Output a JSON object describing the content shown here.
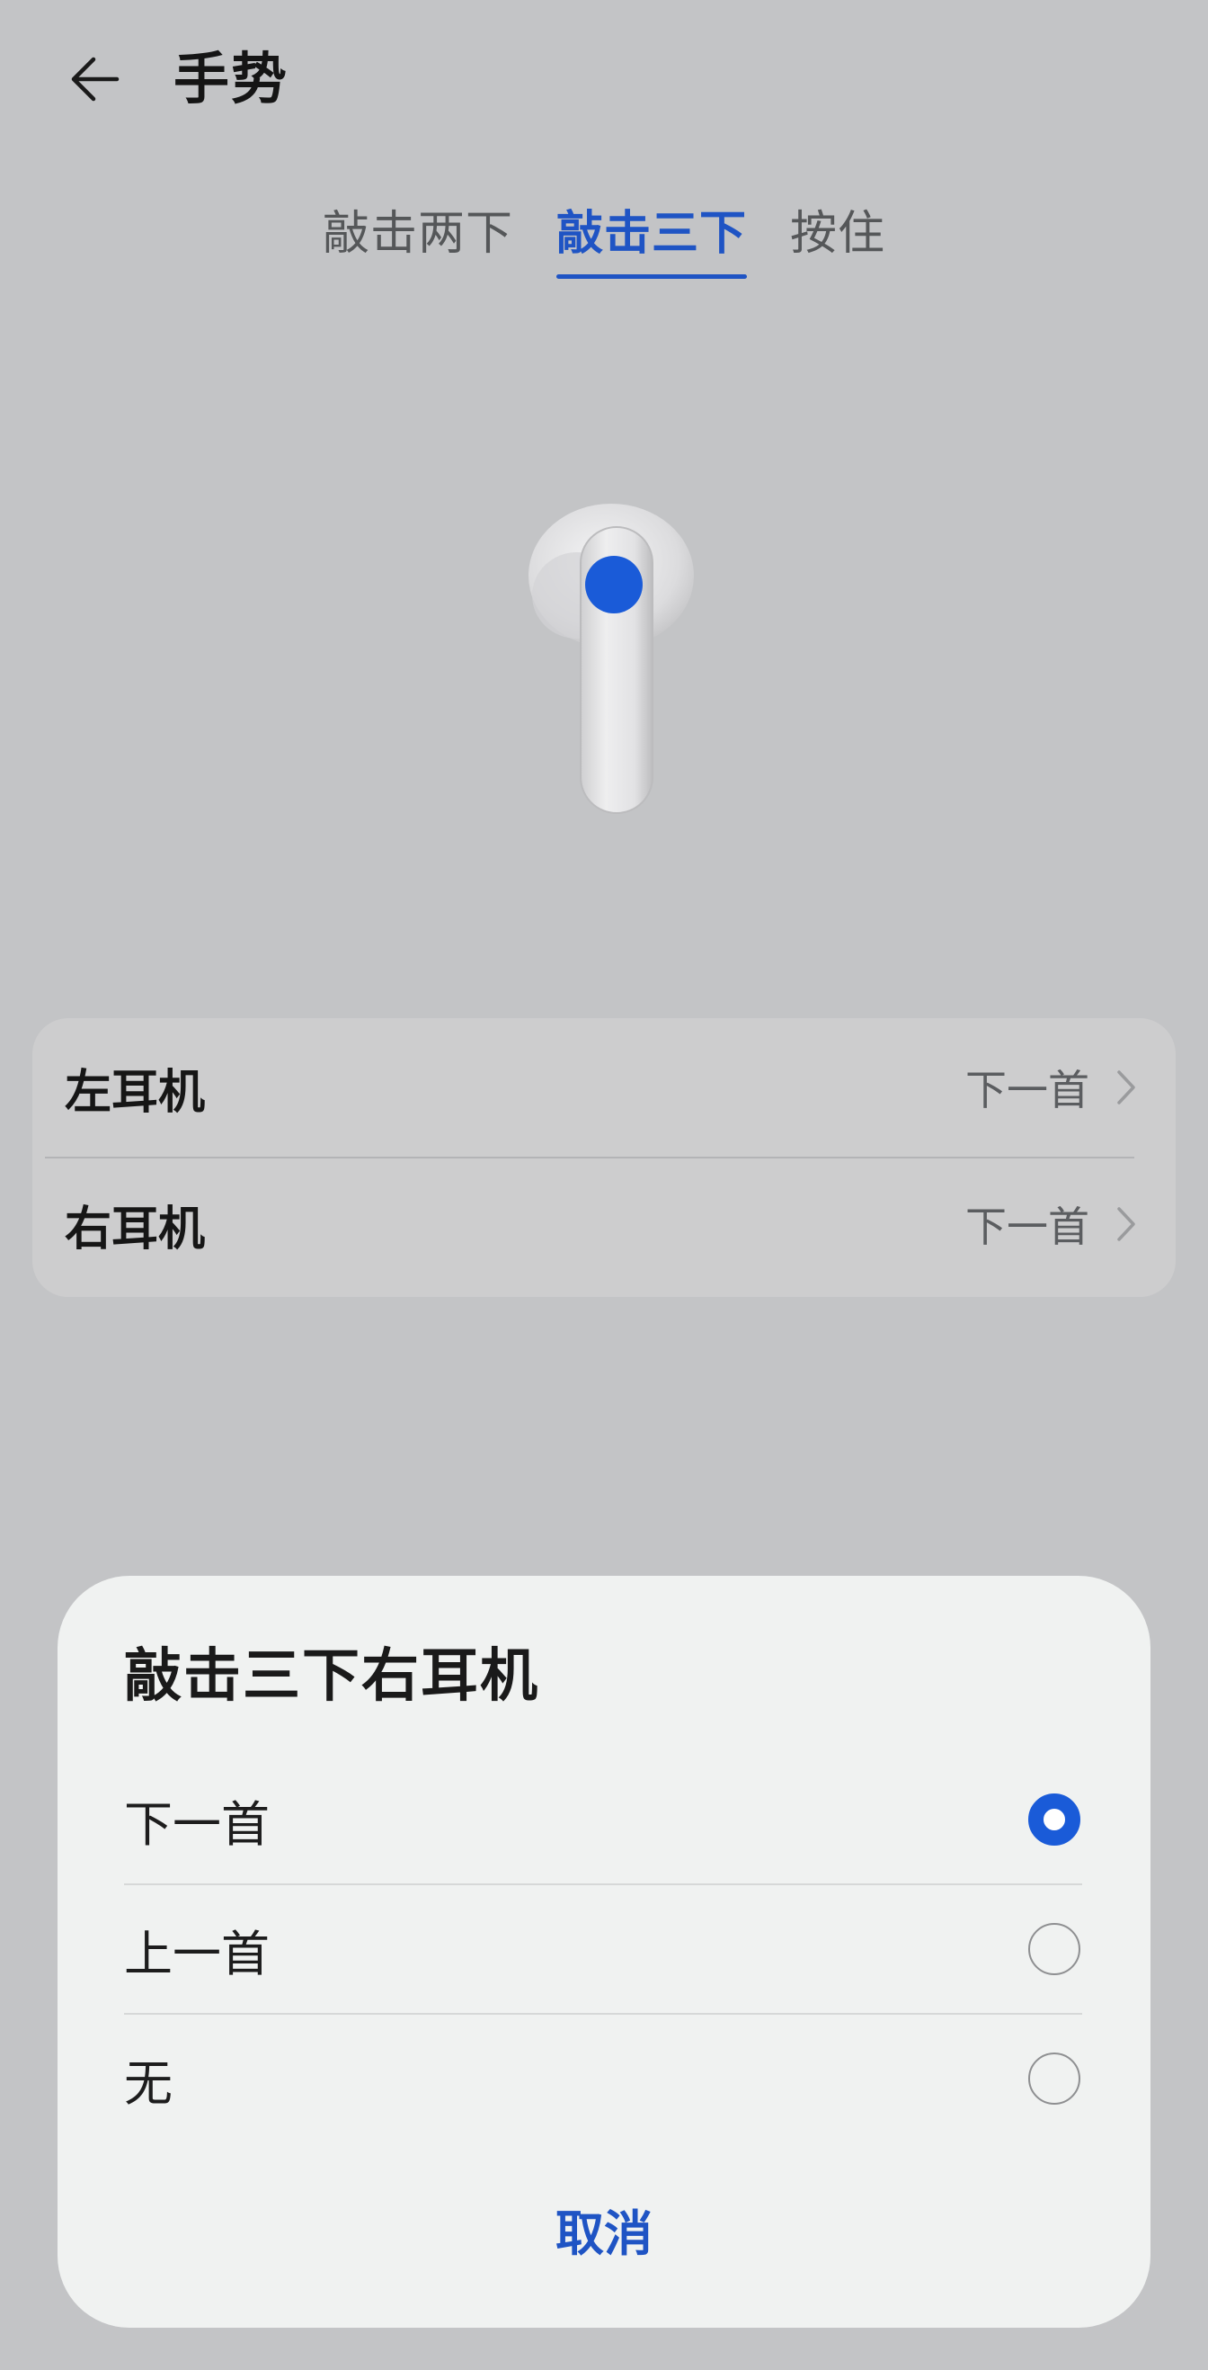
{
  "header": {
    "title": "手势"
  },
  "tabs": [
    {
      "label": "敲击两下",
      "active": false
    },
    {
      "label": "敲击三下",
      "active": true
    },
    {
      "label": "按住",
      "active": false
    }
  ],
  "colors": {
    "accent": "#1f54c4",
    "background": "#c3c4c6",
    "dialog_bg": "#f0f2f1",
    "radio_checked": "#1a5bd8"
  },
  "earbud_settings": [
    {
      "label": "左耳机",
      "value": "下一首"
    },
    {
      "label": "右耳机",
      "value": "下一首"
    }
  ],
  "dialog": {
    "title": "敲击三下右耳机",
    "options": [
      {
        "label": "下一首",
        "selected": true
      },
      {
        "label": "上一首",
        "selected": false
      },
      {
        "label": "无",
        "selected": false
      }
    ],
    "cancel_label": "取消"
  },
  "icons": {
    "back": "arrow-left-icon",
    "chevron": "chevron-right-icon"
  }
}
